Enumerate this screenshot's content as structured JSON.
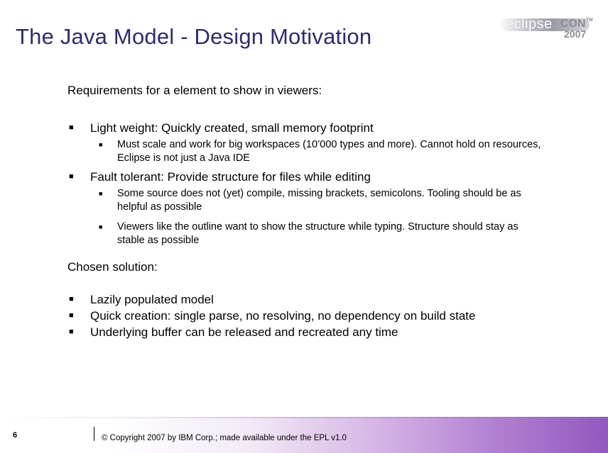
{
  "slide": {
    "title": "The Java Model - Design Motivation",
    "logo": {
      "word": "eclipse",
      "con": "CON",
      "tm": "TM",
      "year": "2007"
    },
    "requirements_heading": "Requirements for a element to show in viewers:",
    "requirements": [
      {
        "text": "Light weight: Quickly created, small memory footprint",
        "sub": [
          "Must scale and work for big workspaces (10’000 types and more). Cannot hold on resources, Eclipse is not just a Java IDE"
        ]
      },
      {
        "text": "Fault tolerant: Provide structure for files while editing",
        "sub": [
          "Some source does not (yet) compile, missing brackets, semicolons. Tooling should be as helpful as possible",
          "Viewers like the outline want to show the structure while typing. Structure should stay as stable as possible"
        ]
      }
    ],
    "solution_heading": "Chosen solution:",
    "solution": [
      "Lazily populated model",
      "Quick creation: single parse, no resolving, no dependency on build state",
      "Underlying buffer can be released and recreated any time"
    ],
    "bullet_glyph": "■",
    "footer": {
      "page_number": "6",
      "copyright": "© Copyright 2007 by IBM Corp.; made available under the EPL v1.0"
    }
  }
}
